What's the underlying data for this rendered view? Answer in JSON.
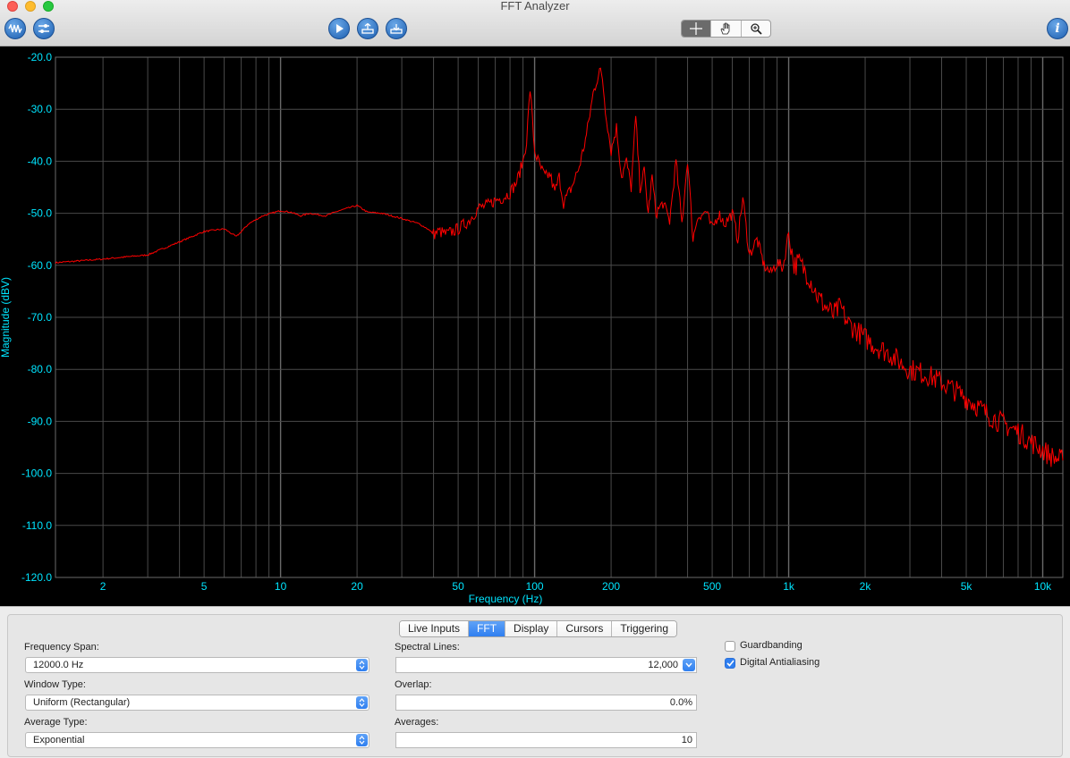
{
  "window": {
    "title": "FFT Analyzer"
  },
  "toolbar": {
    "left_icons": [
      "waveform-icon",
      "settings-icon"
    ],
    "center_icons": [
      "play-icon",
      "export-icon",
      "import-icon"
    ],
    "mode_icons": [
      "crosshair-icon",
      "hand-pan-icon",
      "zoom-icon"
    ],
    "info_icon": "info-icon"
  },
  "chart_data": {
    "type": "line",
    "xlabel": "Frequency (Hz)",
    "ylabel": "Magnitude (dBV)",
    "x_scale": "log",
    "xlim": [
      1.3,
      12000
    ],
    "ylim": [
      -120,
      -20
    ],
    "x_ticks": [
      {
        "value": 2,
        "label": "2"
      },
      {
        "value": 5,
        "label": "5"
      },
      {
        "value": 10,
        "label": "10"
      },
      {
        "value": 20,
        "label": "20"
      },
      {
        "value": 50,
        "label": "50"
      },
      {
        "value": 100,
        "label": "100"
      },
      {
        "value": 200,
        "label": "200"
      },
      {
        "value": 500,
        "label": "500"
      },
      {
        "value": 1000,
        "label": "1k"
      },
      {
        "value": 2000,
        "label": "2k"
      },
      {
        "value": 5000,
        "label": "5k"
      },
      {
        "value": 10000,
        "label": "10k"
      }
    ],
    "y_ticks": [
      {
        "value": -20,
        "label": "-20.0"
      },
      {
        "value": -30,
        "label": "-30.0"
      },
      {
        "value": -40,
        "label": "-40.0"
      },
      {
        "value": -50,
        "label": "-50.0"
      },
      {
        "value": -60,
        "label": "-60.0"
      },
      {
        "value": -70,
        "label": "-70.0"
      },
      {
        "value": -80,
        "label": "-80.0"
      },
      {
        "value": -90,
        "label": "-90.0"
      },
      {
        "value": -100,
        "label": "-100.0"
      },
      {
        "value": -110,
        "label": "-110.0"
      },
      {
        "value": -120,
        "label": "-120.0"
      }
    ],
    "grid": true,
    "colors": {
      "background": "#000000",
      "grid": "#4a4a4a",
      "axis_text": "#00e5ff",
      "trace": "#ff0000"
    },
    "series": [
      {
        "x": [
          1.3,
          2,
          3,
          4,
          5,
          6,
          6.7,
          7.5,
          8.5,
          10,
          11,
          12,
          13,
          15,
          17,
          20,
          22,
          25,
          30,
          35,
          38,
          40,
          42,
          45,
          50,
          55,
          60,
          65,
          70,
          75,
          80,
          85,
          90,
          93,
          96,
          100,
          105,
          110,
          115,
          120,
          125,
          130,
          140,
          150,
          160,
          170,
          180,
          185,
          190,
          200,
          210,
          220,
          230,
          240,
          250,
          260,
          270,
          280,
          290,
          300,
          320,
          340,
          360,
          380,
          400,
          420,
          440,
          450,
          470,
          500,
          530,
          560,
          600,
          630,
          660,
          700,
          750,
          800,
          850,
          900,
          950,
          1000,
          1050,
          1100,
          1200,
          1300,
          1400,
          1500,
          1600,
          1700,
          1800,
          2000,
          2200,
          2500,
          2800,
          3000,
          3500,
          4000,
          4500,
          5000,
          5500,
          6000,
          7000,
          8000,
          9000,
          10000,
          11000,
          12000
        ],
        "y": [
          -59.5,
          -58.8,
          -58.0,
          -55.5,
          -53.5,
          -53.0,
          -54.5,
          -52.0,
          -50.5,
          -49.5,
          -49.8,
          -50.5,
          -50.0,
          -50.5,
          -49.5,
          -48.5,
          -49.8,
          -50.0,
          -51.0,
          -52.0,
          -53.0,
          -54.0,
          -53.5,
          -54.0,
          -53.0,
          -51.5,
          -49.0,
          -48.5,
          -47.5,
          -47.0,
          -46.0,
          -44.0,
          -40.0,
          -36.0,
          -26.0,
          -38.0,
          -41.0,
          -43.0,
          -42.5,
          -46.0,
          -43.0,
          -48.0,
          -45.0,
          -41.0,
          -35.0,
          -27.0,
          -22.5,
          -24.0,
          -30.0,
          -38.0,
          -33.5,
          -43.0,
          -40.0,
          -45.0,
          -31.5,
          -45.0,
          -42.0,
          -50.0,
          -43.0,
          -50.0,
          -48.0,
          -51.5,
          -40.0,
          -52.0,
          -39.5,
          -55.0,
          -50.0,
          -51.0,
          -49.5,
          -53.0,
          -50.0,
          -52.0,
          -50.0,
          -55.0,
          -47.0,
          -58.0,
          -55.0,
          -60.0,
          -61.5,
          -59.5,
          -60.5,
          -53.5,
          -60.0,
          -59.5,
          -62.0,
          -66.0,
          -68.0,
          -69.5,
          -68.0,
          -71.0,
          -72.0,
          -74.0,
          -75.5,
          -77.0,
          -79.0,
          -80.0,
          -81.0,
          -82.5,
          -84.0,
          -85.5,
          -87.0,
          -88.5,
          -90.5,
          -92.0,
          -94.0,
          -95.5,
          -97.0,
          -97.5
        ]
      }
    ]
  },
  "tabs": [
    {
      "label": "Live Inputs",
      "active": false
    },
    {
      "label": "FFT",
      "active": true
    },
    {
      "label": "Display",
      "active": false
    },
    {
      "label": "Cursors",
      "active": false
    },
    {
      "label": "Triggering",
      "active": false
    }
  ],
  "settings": {
    "frequency_span_label": "Frequency Span:",
    "frequency_span_value": "12000.0 Hz",
    "window_type_label": "Window Type:",
    "window_type_value": "Uniform (Rectangular)",
    "average_type_label": "Average Type:",
    "average_type_value": "Exponential",
    "spectral_lines_label": "Spectral Lines:",
    "spectral_lines_value": "12,000",
    "overlap_label": "Overlap:",
    "overlap_value": "0.0%",
    "averages_label": "Averages:",
    "averages_value": "10",
    "guardbanding_label": "Guardbanding",
    "guardbanding_checked": false,
    "antialiasing_label": "Digital Antialiasing",
    "antialiasing_checked": true
  }
}
